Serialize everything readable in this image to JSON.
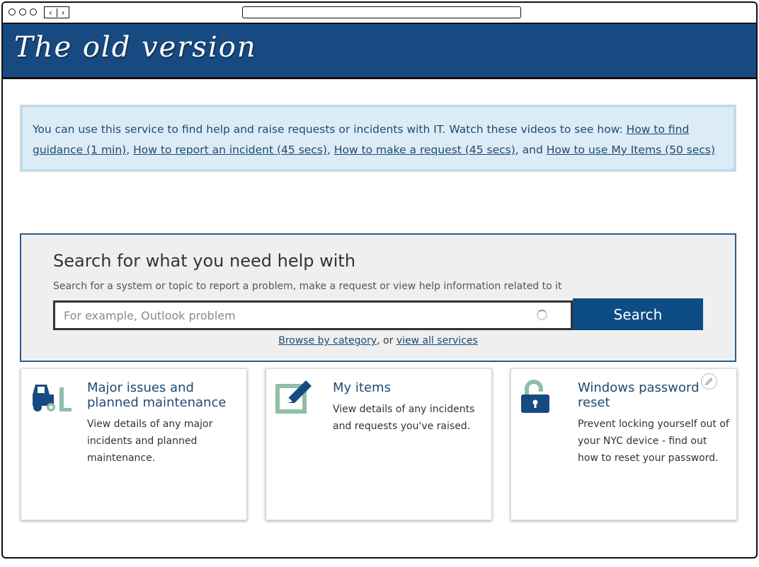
{
  "banner": {
    "title": "The old version"
  },
  "info": {
    "intro": "You can use this service to find help and raise requests or incidents with IT. Watch these videos to see how: ",
    "link1": "How to find guidance (1 min)",
    "link2": "How to report an incident (45 secs)",
    "link3": "How to make a request (45 secs)",
    "link4": "How to use My Items  (50 secs)",
    "sep": ", ",
    "and": ", and "
  },
  "search": {
    "title": "Search for what you need help with",
    "subtitle": "Search for a system or topic to report a problem, make a request or view help information related to it",
    "placeholder": "For example, Outlook problem",
    "value": "",
    "button_label": "Search",
    "browse_link": "Browse by category",
    "browse_sep": ", or ",
    "services_link": "view all services"
  },
  "cards": [
    {
      "title": "Major issues and planned maintenance",
      "text": "View details of any major incidents and planned maintenance.",
      "icon": "forklift-icon"
    },
    {
      "title": "My items",
      "text": "View details of any incidents and requests you've raised.",
      "icon": "edit-document-icon"
    },
    {
      "title": "Windows password reset",
      "text": "Prevent locking yourself out of your NYC device - find out how to reset your password.",
      "icon": "unlock-icon"
    }
  ],
  "colors": {
    "brand": "#174a80",
    "button": "#0d4c85",
    "accent_green": "#8fbfa7",
    "info_bg": "#dcecf6",
    "link": "#1e4a72"
  }
}
